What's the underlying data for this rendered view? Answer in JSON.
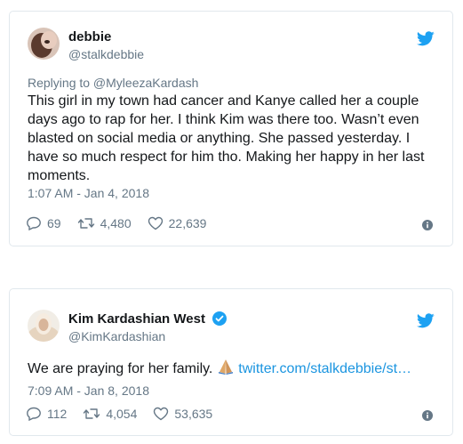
{
  "tweet1": {
    "name": "debbie",
    "handle": "@stalkdebbie",
    "replying_to": "Replying to @MyleezaKardash",
    "text": "This girl in my town had cancer and Kanye called her a couple days ago to rap for her. I think Kim was there too. Wasn’t even blasted on social media or anything. She passed yesterday. I have so much respect for him tho. Making her happy in her last moments.",
    "timestamp": "1:07 AM - Jan 4, 2018",
    "replies": "69",
    "retweets": "4,480",
    "likes": "22,639"
  },
  "tweet2": {
    "name": "Kim Kardashian West",
    "handle": "@KimKardashian",
    "text": "We are praying for her family.",
    "link": "twitter.com/stalkdebbie/st…",
    "timestamp": "7:09 AM - Jan 8, 2018",
    "replies": "112",
    "retweets": "4,054",
    "likes": "53,635"
  },
  "colors": {
    "twitter_blue": "#1da1f2",
    "link_blue": "#1b95e0",
    "secondary_text": "#657786",
    "border": "#e1e8ed"
  },
  "icons": [
    "twitter-bird-icon",
    "reply-icon",
    "retweet-icon",
    "heart-icon",
    "info-icon",
    "verified-badge-icon",
    "praying-hands-emoji"
  ]
}
